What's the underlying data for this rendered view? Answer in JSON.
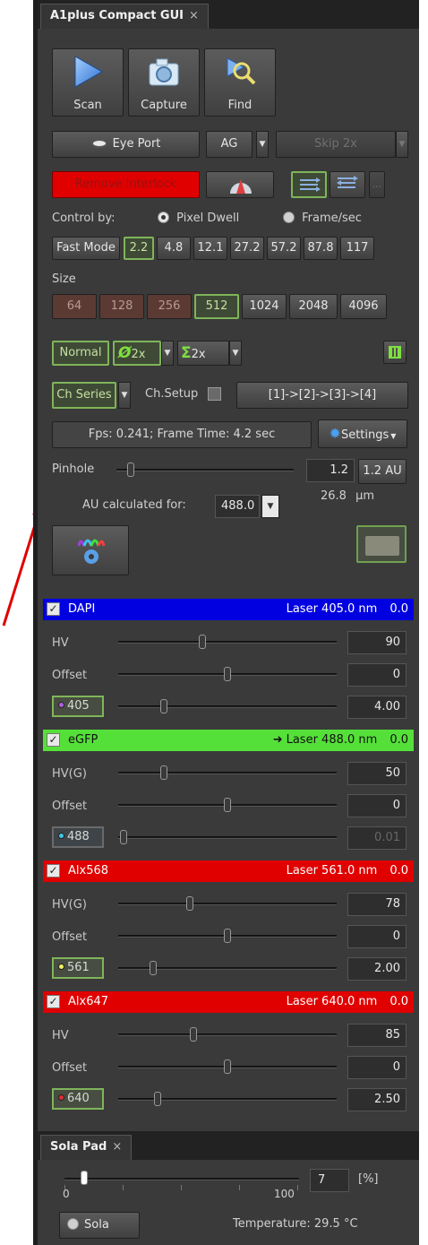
{
  "compact_gui": {
    "tab_title": "A1plus Compact GUI",
    "tab_close": "×",
    "scan_label": "Scan",
    "capture_label": "Capture",
    "find_label": "Find",
    "eye_port_label": "Eye Port",
    "ag_label": "AG",
    "skip_label": "Skip 2x",
    "remove_interlock_label": "Remove Interlock",
    "more_label": "...",
    "control_by_label": "Control by:",
    "pixel_dwell_label": "Pixel Dwell",
    "frame_sec_label": "Frame/sec",
    "pixel_dwell_selected": true,
    "fast_mode_label": "Fast Mode",
    "dwell_options": [
      "2.2",
      "4.8",
      "12.1",
      "27.2",
      "57.2",
      "87.8",
      "117"
    ],
    "dwell_selected": "2.2",
    "size_label": "Size",
    "size_options": [
      "64",
      "128",
      "256",
      "512",
      "1024",
      "2048",
      "4096"
    ],
    "size_selected": "512",
    "normal_label": "Normal",
    "line_avg_label": "2x",
    "integrate_label": "2x",
    "ch_series_label": "Ch Series",
    "ch_setup_label": "Ch.Setup",
    "ch_sequence": "[1]->[2]->[3]->[4]",
    "fps_text": "Fps: 0.241; Frame Time: 4.2 sec",
    "settings_label": "Settings",
    "pinhole_label": "Pinhole",
    "pinhole_value": "1.2",
    "pinhole_au_label": "1.2 AU",
    "pinhole_um_value": "26.8",
    "pinhole_um_unit": "µm",
    "au_calc_label": "AU calculated for:",
    "au_calc_value": "488.0",
    "channels": [
      {
        "name": "DAPI",
        "header_color": "#0000e0",
        "arrow": "",
        "laser": "Laser 405.0 nm",
        "laser_power_header": "0.0",
        "hv_label": "HV",
        "hv_value": "90",
        "hv_level": 0.38,
        "offset_label": "Offset",
        "offset_value": "0",
        "offset_level": 0.5,
        "laser_button": "405",
        "laser_dot": "#b060e0",
        "laser_value": "4.00",
        "laser_level": 0.2,
        "laser_enabled": true
      },
      {
        "name": "eGFP",
        "header_color": "#55e039",
        "arrow": "➜",
        "laser": "Laser 488.0 nm",
        "laser_power_header": "0.0",
        "hv_label": "HV(G)",
        "hv_value": "50",
        "hv_level": 0.2,
        "offset_label": "Offset",
        "offset_value": "0",
        "offset_level": 0.5,
        "laser_button": "488",
        "laser_dot": "#40c8e8",
        "laser_value": "0.01",
        "laser_level": 0.01,
        "laser_enabled": false
      },
      {
        "name": "Alx568",
        "header_color": "#e00000",
        "arrow": "",
        "laser": "Laser 561.0 nm",
        "laser_power_header": "0.0",
        "hv_label": "HV(G)",
        "hv_value": "78",
        "hv_level": 0.32,
        "offset_label": "Offset",
        "offset_value": "0",
        "offset_level": 0.5,
        "laser_button": "561",
        "laser_dot": "#f0f060",
        "laser_value": "2.00",
        "laser_level": 0.15,
        "laser_enabled": true
      },
      {
        "name": "Alx647",
        "header_color": "#e00000",
        "arrow": "",
        "laser": "Laser 640.0 nm",
        "laser_power_header": "0.0",
        "hv_label": "HV",
        "hv_value": "85",
        "hv_level": 0.34,
        "offset_label": "Offset",
        "offset_value": "0",
        "offset_level": 0.5,
        "laser_button": "640",
        "laser_dot": "#e03030",
        "laser_value": "2.50",
        "laser_level": 0.17,
        "laser_enabled": true
      }
    ]
  },
  "sola_pad": {
    "tab_title": "Sola Pad",
    "tab_close": "×",
    "slider_level": 0.07,
    "scale_min": "0",
    "scale_max": "100",
    "value": "7",
    "unit": "[%]",
    "sola_label": "Sola",
    "temperature_text": "Temperature: 29.5 °C"
  }
}
